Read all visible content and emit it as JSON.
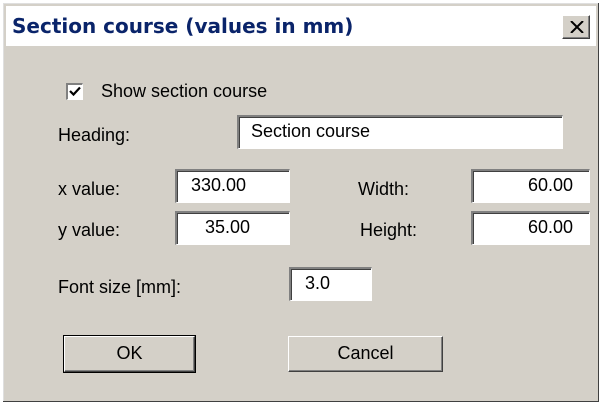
{
  "window": {
    "title": "Section course (values in mm)",
    "close_icon": "close-x-icon"
  },
  "show_section_course": {
    "label": "Show section course",
    "checked": true
  },
  "heading": {
    "label": "Heading:",
    "value": "Section course"
  },
  "x_value": {
    "label": "x value:",
    "value": "330.00"
  },
  "y_value": {
    "label": "y value:",
    "value": "35.00"
  },
  "width": {
    "label": "Width:",
    "value": "60.00"
  },
  "height": {
    "label": "Height:",
    "value": "60.00"
  },
  "font_size": {
    "label": "Font size [mm]:",
    "value": "3.0"
  },
  "buttons": {
    "ok": "OK",
    "cancel": "Cancel"
  },
  "colors": {
    "dialog_face": "#d4d0c8",
    "title_text": "#0a246a"
  }
}
